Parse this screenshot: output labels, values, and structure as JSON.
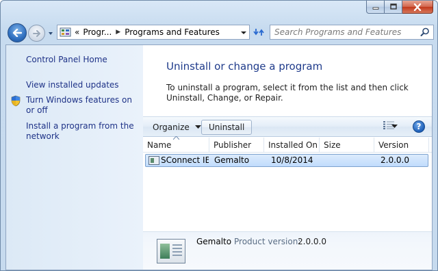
{
  "window": {
    "caption_buttons": [
      "minimize",
      "maximize",
      "close"
    ]
  },
  "address_bar": {
    "overflow": "«",
    "crumbs": [
      "Progr...",
      "Programs and Features"
    ]
  },
  "search": {
    "placeholder": "Search Programs and Features"
  },
  "left_pane": {
    "links": [
      "Control Panel Home",
      "View installed updates",
      "Turn Windows features on or off",
      "Install a program from the network"
    ]
  },
  "main": {
    "heading": "Uninstall or change a program",
    "description": "To uninstall a program, select it from the list and then click Uninstall, Change, or Repair."
  },
  "toolbar": {
    "organize_label": "Organize",
    "uninstall_label": "Uninstall",
    "help_label": "?"
  },
  "table": {
    "columns": [
      "Name",
      "Publisher",
      "Installed On",
      "Size",
      "Version"
    ],
    "rows": [
      {
        "name": "SConnect IE",
        "publisher": "Gemalto",
        "installed_on": "10/8/2014",
        "size": "",
        "version": "2.0.0.0",
        "selected": true
      }
    ]
  },
  "details": {
    "publisher": "Gemalto",
    "product_version_label": "Product version:",
    "product_version": "2.0.0.0"
  }
}
